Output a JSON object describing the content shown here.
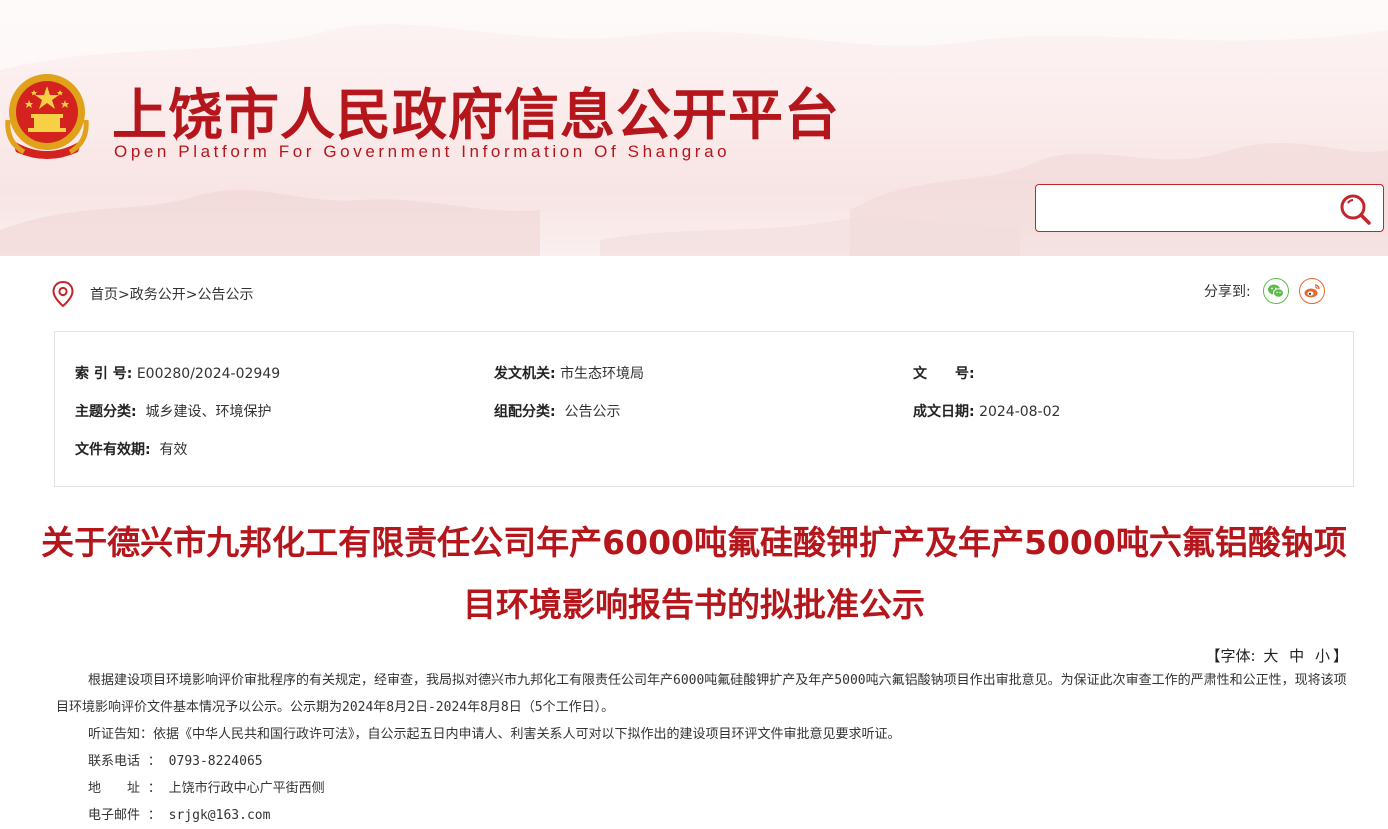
{
  "header": {
    "site_title": "上饶市人民政府信息公开平台",
    "site_subtitle": "Open Platform For Government Information Of Shangrao",
    "search": {
      "placeholder": "",
      "value": ""
    },
    "accent_color": "#b5161c"
  },
  "breadcrumb": {
    "items": [
      "首页",
      "政务公开",
      "公告公示"
    ],
    "separator": ">"
  },
  "share": {
    "label": "分享到:",
    "targets": [
      "wechat-icon",
      "weibo-icon"
    ]
  },
  "meta": {
    "index_no": {
      "label": "索 引 号:",
      "value": "E00280/2024-02949"
    },
    "issuer": {
      "label": "发文机关:",
      "value": "市生态环境局"
    },
    "doc_no": {
      "label": "文　　号:",
      "value": ""
    },
    "topic": {
      "label": "主题分类:",
      "value": "城乡建设、环境保护"
    },
    "category": {
      "label": "组配分类:",
      "value": "公告公示"
    },
    "date": {
      "label": "成文日期:",
      "value": "2024-08-02"
    },
    "validity": {
      "label": "文件有效期:",
      "value": "有效"
    }
  },
  "article": {
    "title": "关于德兴市九邦化工有限责任公司年产6000吨氟硅酸钾扩产及年产5000吨六氟铝酸钠项目环境影响报告书的拟批准公示",
    "font_size_control": {
      "prefix": "【字体:",
      "large": "大",
      "medium": "中",
      "small": "小",
      "suffix": "】"
    },
    "paragraphs": [
      "根据建设项目环境影响评价审批程序的有关规定，经审查，我局拟对德兴市九邦化工有限责任公司年产6000吨氟硅酸钾扩产及年产5000吨六氟铝酸钠项目作出审批意见。为保证此次审查工作的严肃性和公正性，现将该项目环境影响评价文件基本情况予以公示。公示期为2024年8月2日-2024年8月8日（5个工作日）。",
      "听证告知：依据《中华人民共和国行政许可法》，自公示起五日内申请人、利害关系人可对以下拟作出的建设项目环评文件审批意见要求听证。"
    ],
    "contacts": [
      {
        "label": "联系电话",
        "value": "0793-8224065"
      },
      {
        "label": "地　　址",
        "value": "上饶市行政中心广平街西侧"
      },
      {
        "label": "电子邮件",
        "value": "srjgk@163.com"
      }
    ]
  }
}
